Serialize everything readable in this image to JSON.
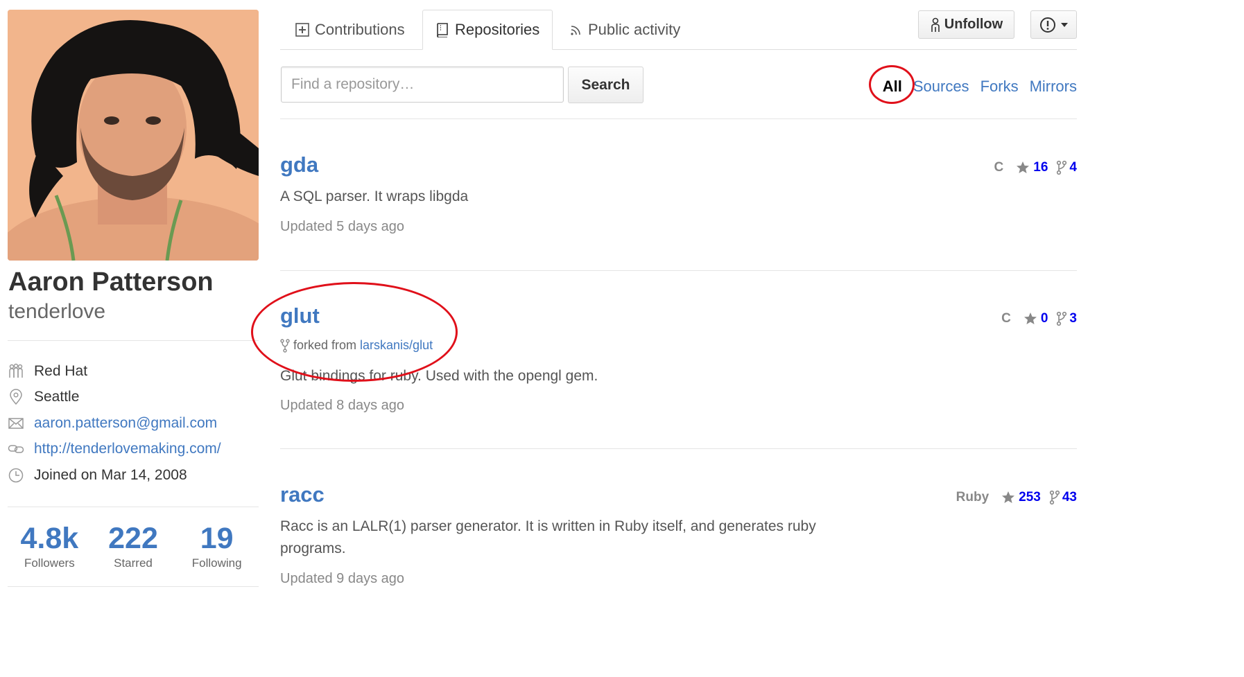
{
  "profile": {
    "full_name": "Aaron Patterson",
    "username": "tenderlove",
    "details": {
      "organization": "Red Hat",
      "location": "Seattle",
      "email": "aaron.patterson@gmail.com",
      "website": "http://tenderlovemaking.com/",
      "joined": "Joined on Mar 14, 2008"
    },
    "stats": [
      {
        "value": "4.8k",
        "label": "Followers"
      },
      {
        "value": "222",
        "label": "Starred"
      },
      {
        "value": "19",
        "label": "Following"
      }
    ]
  },
  "tabs": {
    "contributions": "Contributions",
    "repositories": "Repositories",
    "public_activity": "Public activity",
    "selected": "Repositories"
  },
  "actions": {
    "unfollow": "Unfollow"
  },
  "search": {
    "placeholder": "Find a repository…",
    "button": "Search"
  },
  "filters": {
    "all": "All",
    "sources": "Sources",
    "forks": "Forks",
    "mirrors": "Mirrors",
    "selected": "All"
  },
  "repos": [
    {
      "name": "gda",
      "description": "A SQL parser. It wraps libgda",
      "updated": "Updated 5 days ago",
      "language": "C",
      "stars": "16",
      "forks": "4"
    },
    {
      "name": "glut",
      "fork_prefix": "forked from",
      "fork_source": "larskanis/glut",
      "description": "Glut bindings for ruby. Used with the opengl gem.",
      "updated": "Updated 8 days ago",
      "language": "C",
      "stars": "0",
      "forks": "3"
    },
    {
      "name": "racc",
      "description": "Racc is an LALR(1) parser generator. It is written in Ruby itself, and generates ruby programs.",
      "updated": "Updated 9 days ago",
      "language": "Ruby",
      "stars": "253",
      "forks": "43"
    }
  ],
  "colors": {
    "link": "#4078c0",
    "annotation_circle": "#e0101a",
    "muted": "#888888"
  },
  "icons": {
    "contributions": "plus-square-icon",
    "repositories": "book-icon",
    "public_activity": "rss-icon",
    "unfollow": "person-icon",
    "report": "alert-circle-icon",
    "organization": "organization-icon",
    "location": "location-pin-icon",
    "email": "mail-icon",
    "website": "link-icon",
    "joined": "clock-icon",
    "star": "star-icon",
    "fork": "fork-icon"
  }
}
